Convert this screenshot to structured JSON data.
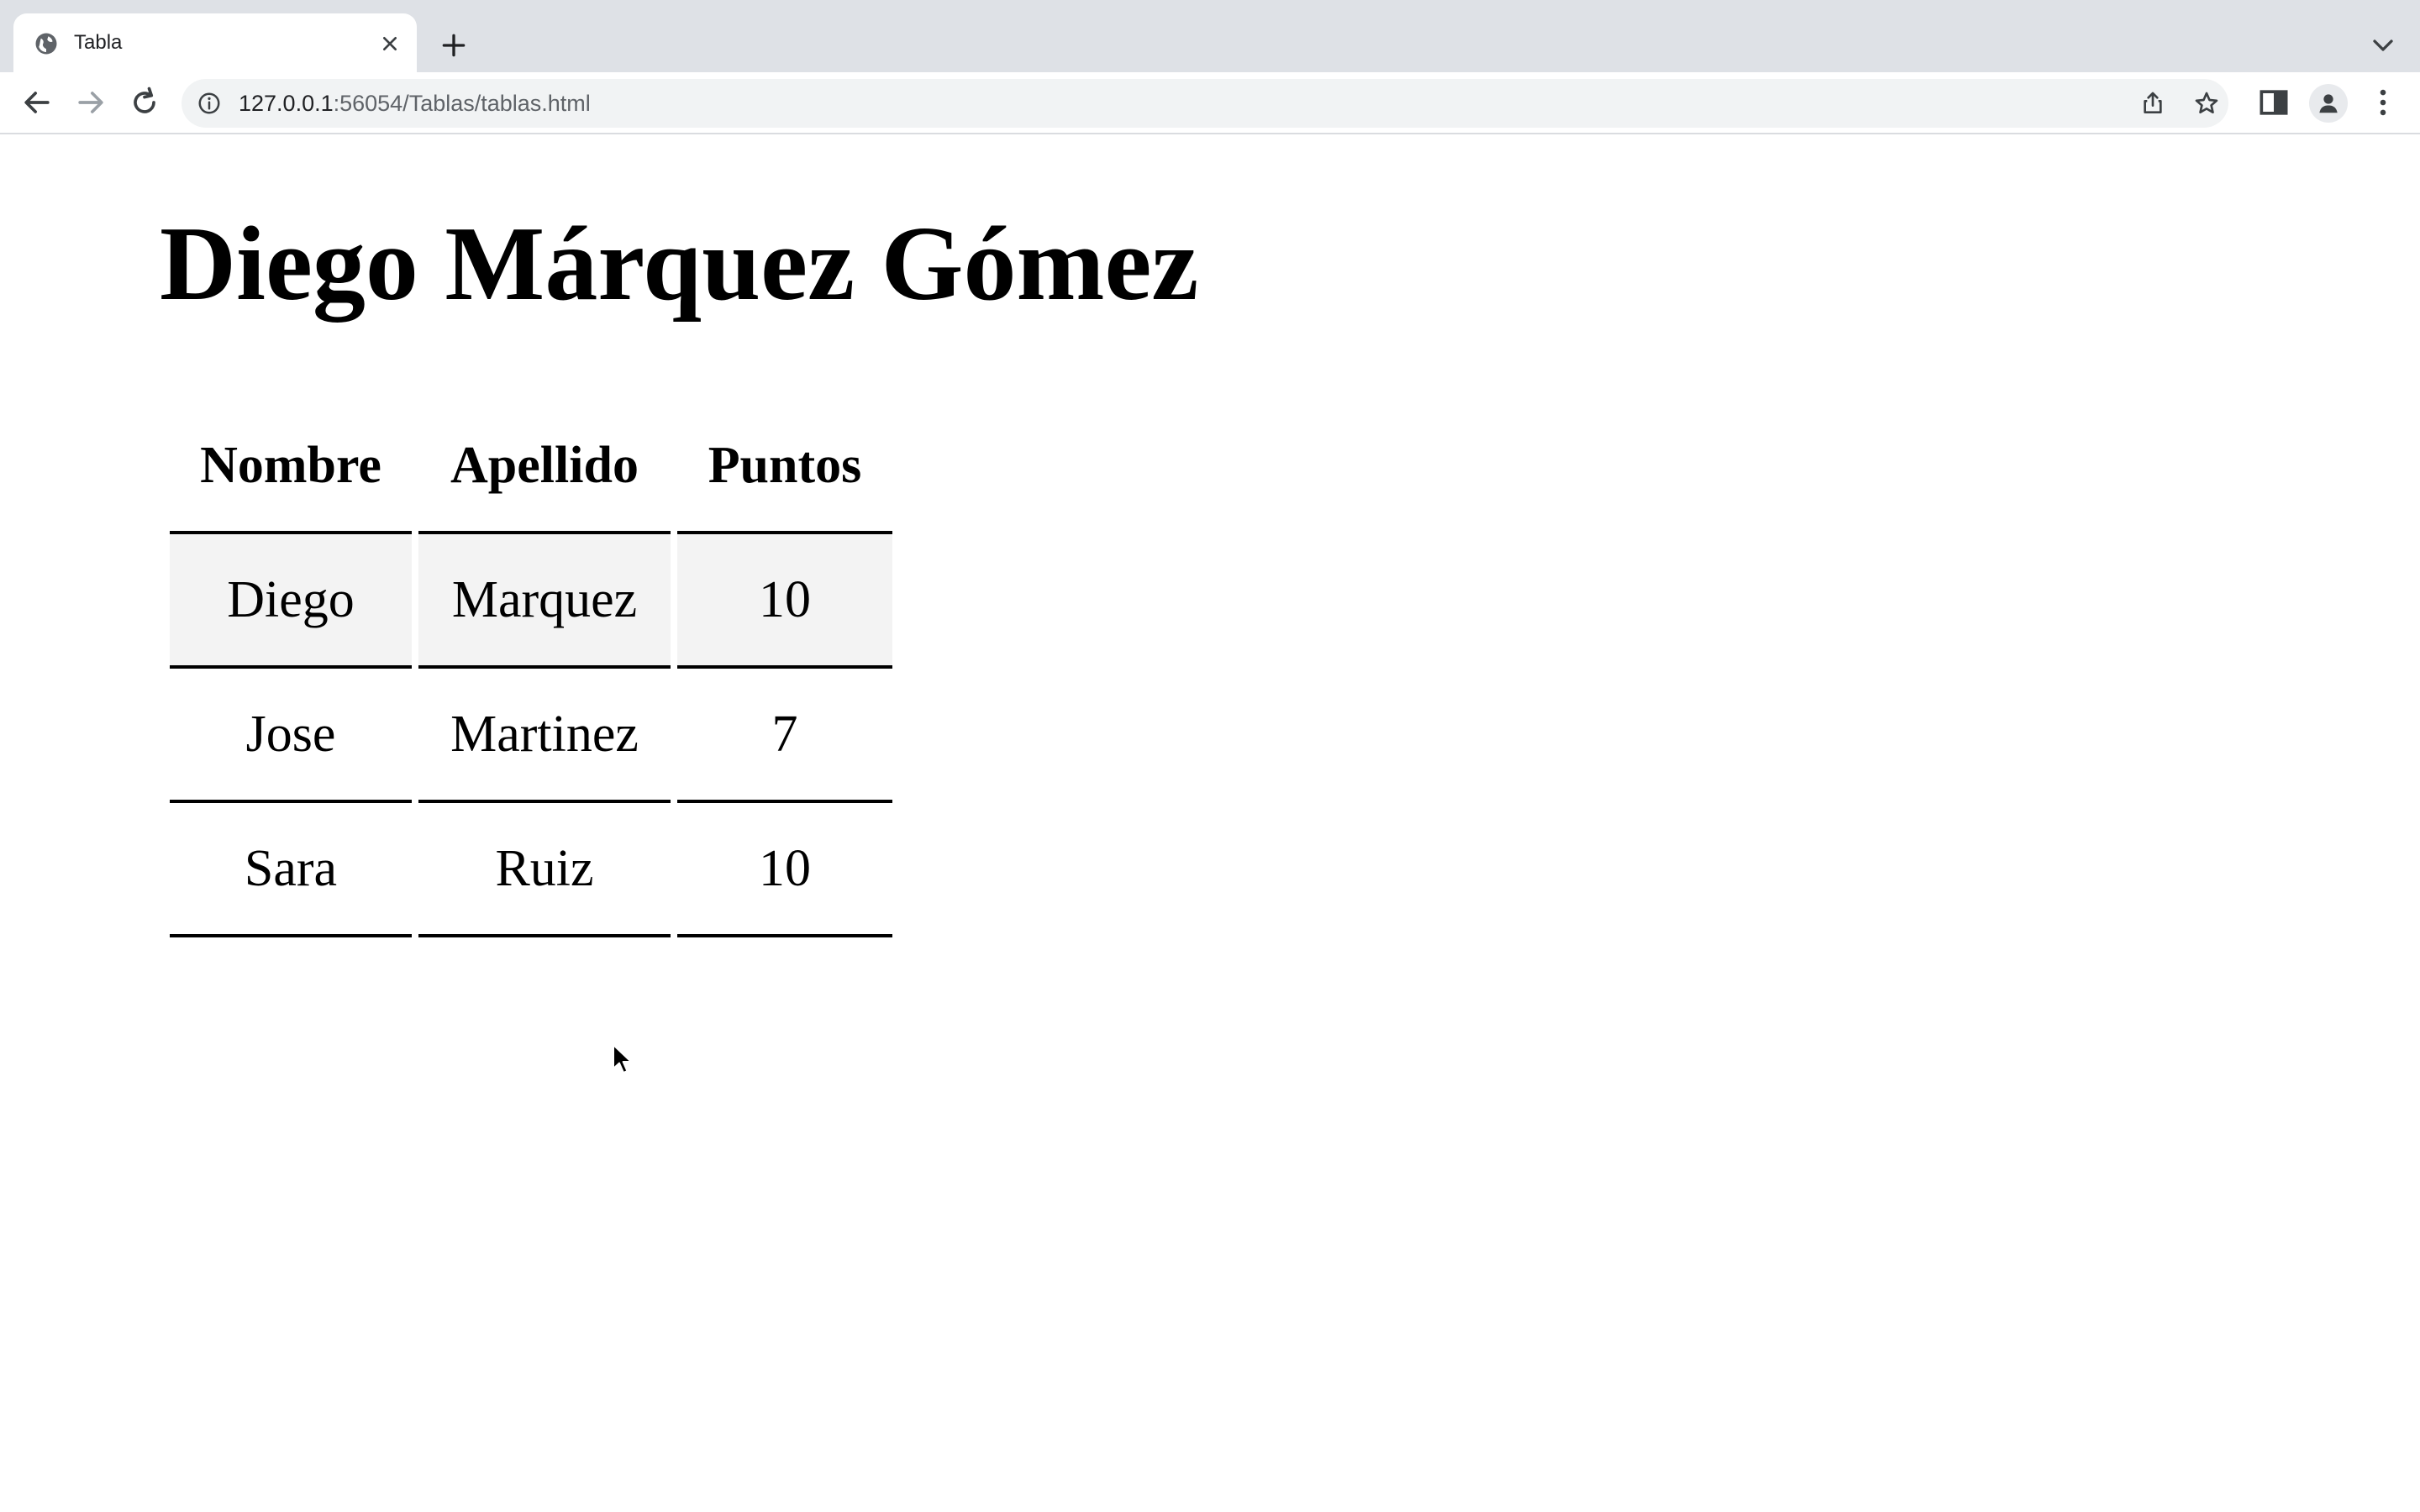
{
  "browser": {
    "tab": {
      "title": "Tabla"
    },
    "address_bar": {
      "host": "127.0.0.1",
      "rest": ":56054/Tablas/tablas.html"
    },
    "icons": [
      "globe-icon",
      "close-icon",
      "plus-icon",
      "chevron-down-icon",
      "back-arrow-icon",
      "forward-arrow-icon",
      "reload-icon",
      "info-icon",
      "share-icon",
      "star-icon",
      "side-panel-icon",
      "profile-icon",
      "kebab-menu-icon"
    ]
  },
  "page": {
    "heading": "Diego Márquez Gómez",
    "table": {
      "headers": [
        "Nombre",
        "Apellido",
        "Puntos"
      ],
      "rows": [
        [
          "Diego",
          "Marquez",
          "10"
        ],
        [
          "Jose",
          "Martinez",
          "7"
        ],
        [
          "Sara",
          "Ruiz",
          "10"
        ]
      ]
    }
  },
  "colors": {
    "tabstrip_bg": "#dee1e6",
    "omnibox_bg": "#f1f3f4",
    "highlight_row_bg": "#f3f3f3",
    "text": "#000000"
  }
}
